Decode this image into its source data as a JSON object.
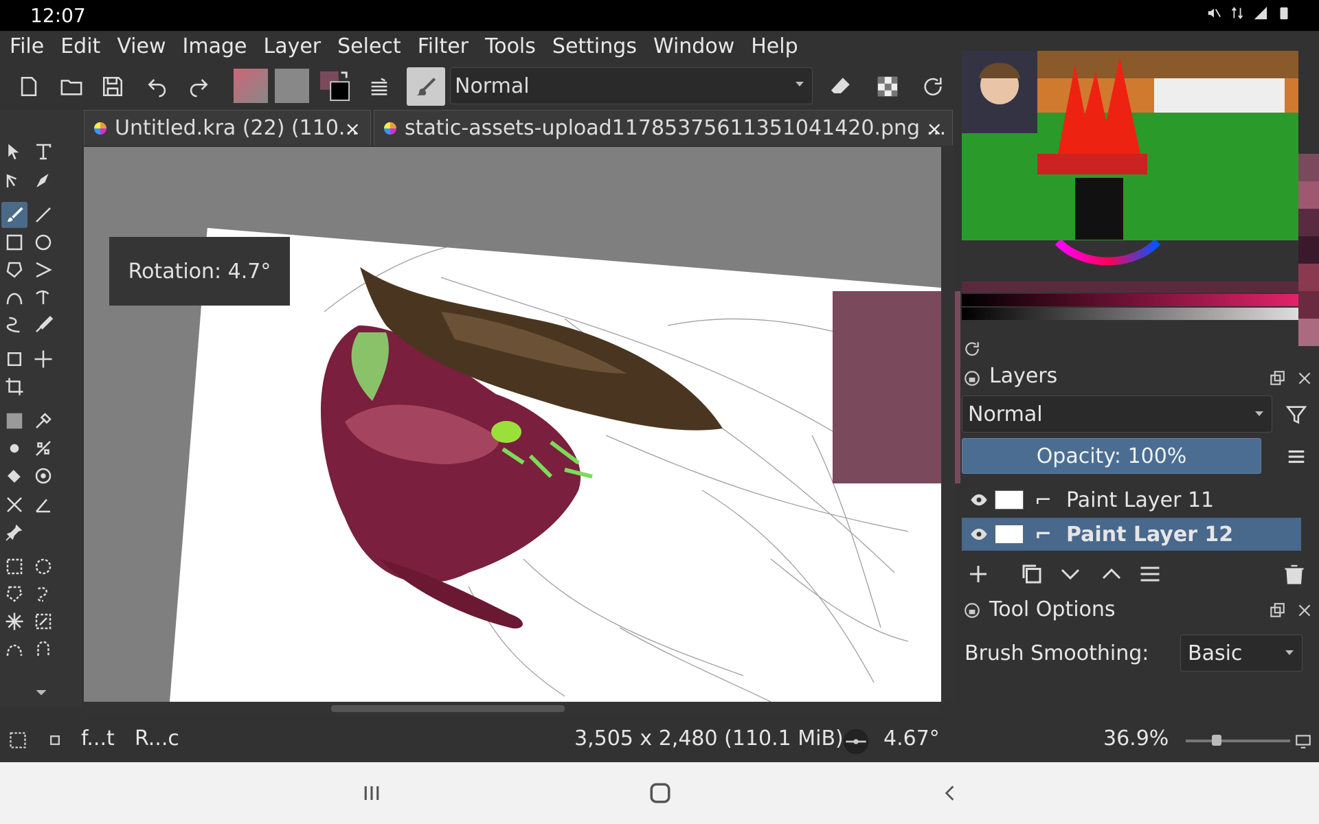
{
  "status_bar": {
    "time": "12:07"
  },
  "menu": [
    {
      "label": "File"
    },
    {
      "label": "Edit"
    },
    {
      "label": "View"
    },
    {
      "label": "Image"
    },
    {
      "label": "Layer"
    },
    {
      "label": "Select"
    },
    {
      "label": "Filter"
    },
    {
      "label": "Tools"
    },
    {
      "label": "Settings"
    },
    {
      "label": "Window"
    },
    {
      "label": "Help"
    }
  ],
  "toolbar": {
    "blend_mode": "Normal"
  },
  "tabs": [
    {
      "label": "Untitled.kra (22) (110..."
    },
    {
      "label": "static-assets-upload11785375611351041420.png ..."
    }
  ],
  "canvas": {
    "rotation_label": "Rotation: 4.7°",
    "swatch_color": "#7a4a5c"
  },
  "layers": {
    "title": "Layers",
    "blend_mode": "Normal",
    "opacity_label": "Opacity:  100%",
    "items": [
      {
        "name": "Paint Layer 11",
        "selected": false
      },
      {
        "name": "Paint Layer 12",
        "selected": true
      }
    ]
  },
  "tool_options": {
    "title": "Tool Options",
    "brush_smoothing_label": "Brush Smoothing:",
    "brush_smoothing_value": "Basic"
  },
  "bottom_status": {
    "item1": "f...t",
    "item2": "R...c",
    "image_size": "3,505 x 2,480 (110.1 MiB)",
    "rotation": "4.67°",
    "zoom": "36.9%"
  },
  "colors": {
    "accent": "#4b6d91",
    "foreground": "#7a4a5c",
    "background": "#ffffff"
  }
}
